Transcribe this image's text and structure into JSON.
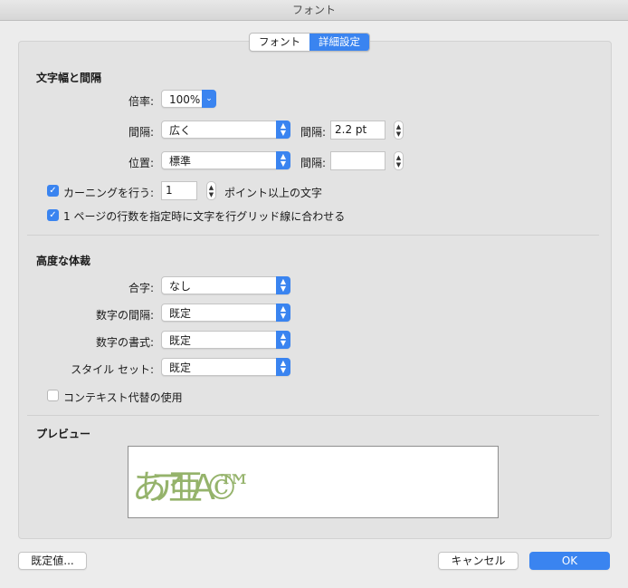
{
  "window": {
    "title": "フォント"
  },
  "tabs": [
    {
      "label": "フォント",
      "active": false
    },
    {
      "label": "詳細設定",
      "active": true
    }
  ],
  "spacing": {
    "title": "文字幅と間隔",
    "scale_label": "倍率:",
    "scale_value": "100%",
    "spacing_label": "間隔:",
    "spacing_value": "広く",
    "spacing_by_label": "間隔:",
    "spacing_by_value": "2.2 pt",
    "position_label": "位置:",
    "position_value": "標準",
    "position_by_label": "間隔:",
    "position_by_value": "",
    "kerning_label": "カーニングを行う:",
    "kerning_checked": true,
    "kerning_value": "1",
    "kerning_suffix": "ポイント以上の文字",
    "grid_label": "1 ページの行数を指定時に文字を行グリッド線に合わせる",
    "grid_checked": true
  },
  "typography": {
    "title": "高度な体裁",
    "ligatures_label": "合字:",
    "ligatures_value": "なし",
    "number_spacing_label": "数字の間隔:",
    "number_spacing_value": "既定",
    "number_forms_label": "数字の書式:",
    "number_forms_value": "既定",
    "stylistic_label": "スタイル セット:",
    "stylistic_value": "既定",
    "contextual_label": "コンテキスト代替の使用",
    "contextual_checked": false
  },
  "preview": {
    "title": "プレビュー",
    "sample": "あア亜Ａ© ™",
    "color": "#8aab5c"
  },
  "buttons": {
    "default": "既定値...",
    "cancel": "キャンセル",
    "ok": "OK"
  },
  "colors": {
    "accent": "#3a84f0"
  }
}
